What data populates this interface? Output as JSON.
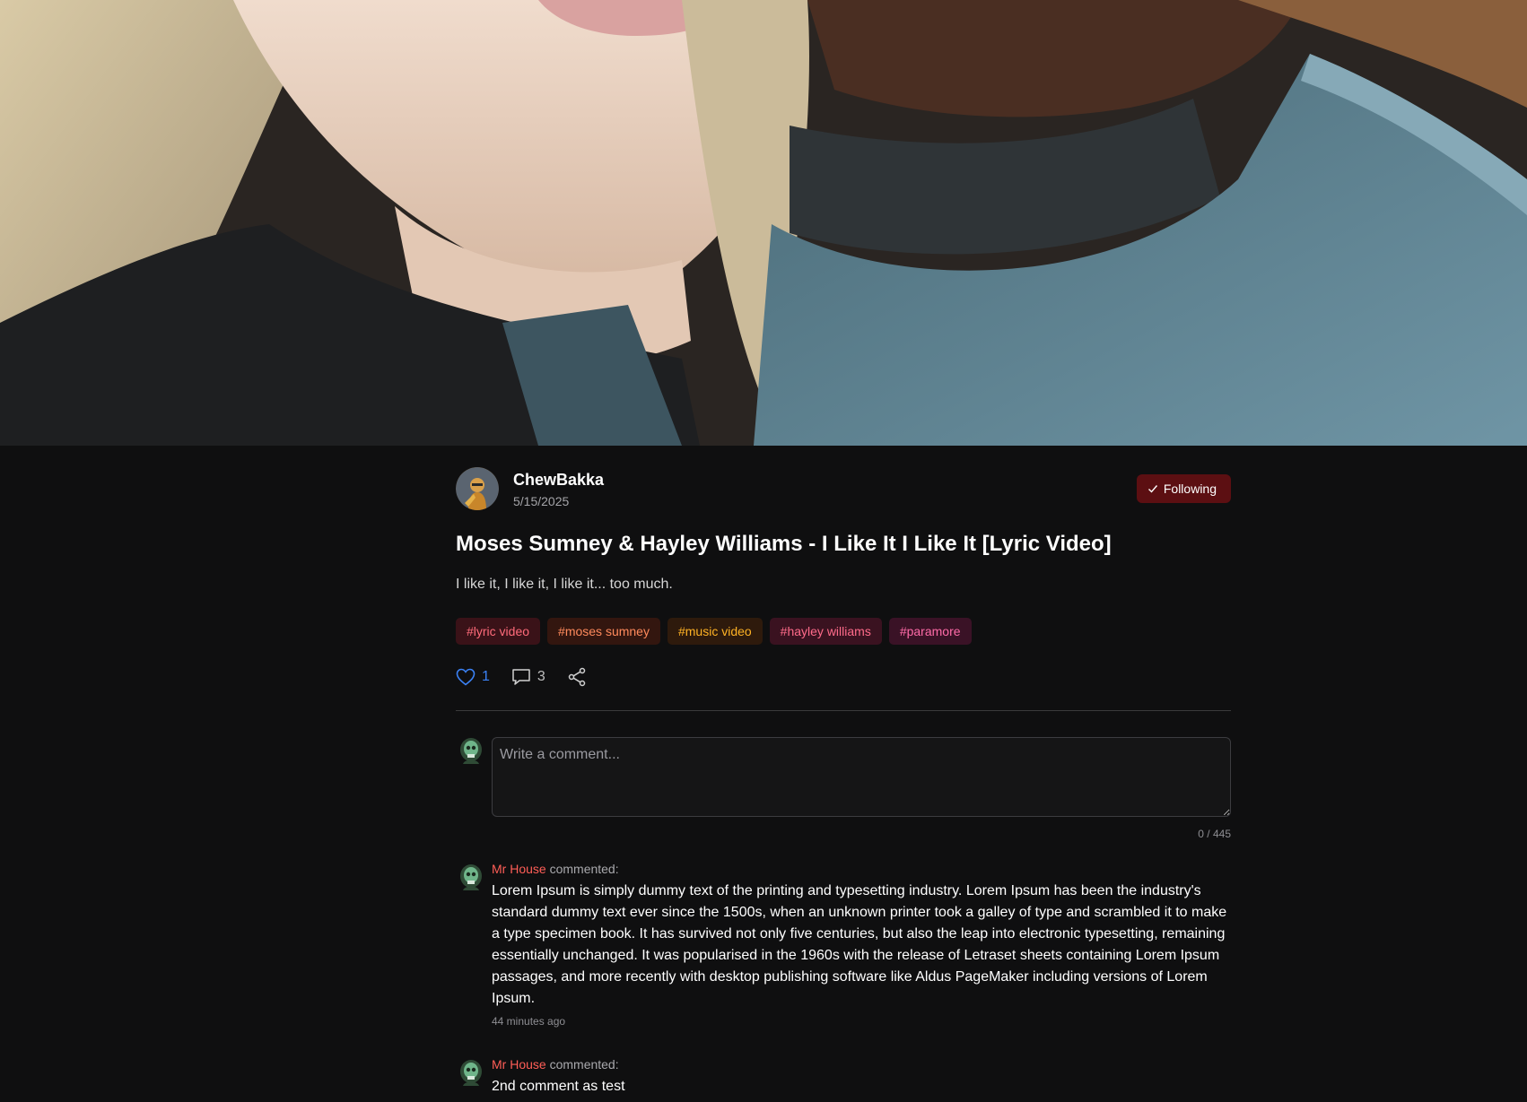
{
  "post": {
    "author": "ChewBakka",
    "date": "5/15/2025",
    "follow_label": "Following",
    "title": "Moses Sumney & Hayley Williams - I Like It I Like It [Lyric Video]",
    "description": "I like it, I like it, I like it... too much.",
    "tags": [
      {
        "label": "#lyric video",
        "color": "#ff6b7a",
        "bg": "#3a1218"
      },
      {
        "label": "#moses sumney",
        "color": "#ff8a5c",
        "bg": "#33160f"
      },
      {
        "label": "#music video",
        "color": "#ffb224",
        "bg": "#2e1a0c"
      },
      {
        "label": "#hayley williams",
        "color": "#ff6b8a",
        "bg": "#3a1220"
      },
      {
        "label": "#paramore",
        "color": "#ff6ba8",
        "bg": "#3a1226"
      }
    ],
    "likes": "1",
    "comments_count": "3",
    "like_color": "#3b82f6"
  },
  "composer": {
    "placeholder": "Write a comment...",
    "char_count": "0 / 445"
  },
  "comments": [
    {
      "user": "Mr House",
      "action": " commented:",
      "body": "Lorem Ipsum is simply dummy text of the printing and typesetting industry. Lorem Ipsum has been the industry's standard dummy text ever since the 1500s, when an unknown printer took a galley of type and scrambled it to make a type specimen book. It has survived not only five centuries, but also the leap into electronic typesetting, remaining essentially unchanged. It was popularised in the 1960s with the release of Letraset sheets containing Lorem Ipsum passages, and more recently with desktop publishing software like Aldus PageMaker including versions of Lorem Ipsum.",
      "time": "44 minutes ago"
    },
    {
      "user": "Mr House",
      "action": " commented:",
      "body": "2nd comment as test",
      "time": ""
    }
  ],
  "icons": {
    "avatar": "user-avatar",
    "follow": "check-icon",
    "like": "heart-icon",
    "comment": "speech-bubble-icon",
    "share": "share-icon",
    "commenter": "skull-avatar-icon"
  }
}
